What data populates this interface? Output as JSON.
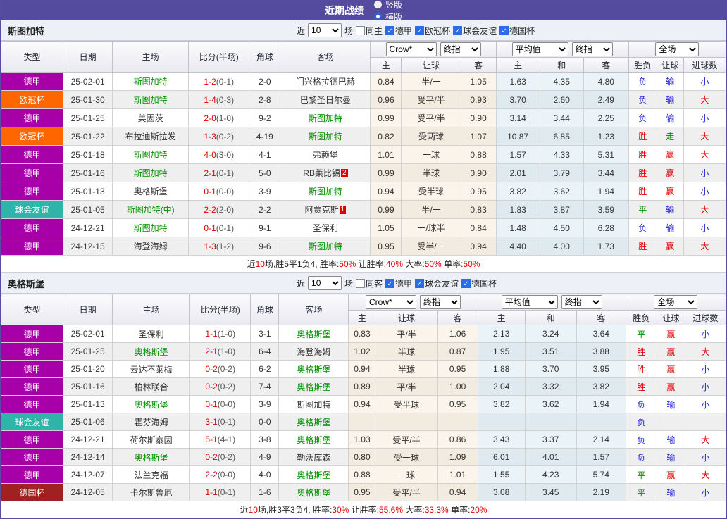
{
  "page": {
    "title": "近期战绩",
    "view_options": [
      {
        "label": "竖版",
        "checked": false
      },
      {
        "label": "横版",
        "checked": true
      }
    ]
  },
  "columns": {
    "main": [
      "类型",
      "日期",
      "主场",
      "比分(半场)",
      "角球",
      "客场"
    ],
    "sub": [
      "主",
      "让球",
      "客",
      "主",
      "和",
      "客",
      "胜负",
      "让球",
      "进球数"
    ],
    "selects": {
      "book": "Crow*",
      "final_a": "终指",
      "avg": "平均值",
      "final_b": "终指",
      "scope": "全场"
    }
  },
  "league_colors": {
    "德甲": "#a800a8",
    "欧冠杯": "#ff6600",
    "球会友谊": "#2fb4a9",
    "德国杯": "#a02121"
  },
  "result_colors": {
    "red": "#e00000",
    "blue": "#2424d8",
    "green": "#009000"
  },
  "sections": [
    {
      "team": "斯图加特",
      "filter": {
        "near": "近",
        "count": "10",
        "games": "场",
        "same": "同主",
        "leagues": [
          "德甲",
          "欧冠杯",
          "球会友谊",
          "德国杯"
        ]
      },
      "rows": [
        {
          "league": "德甲",
          "date": "25-02-01",
          "home": {
            "name": "斯图加特",
            "hl": true,
            "badge": null
          },
          "score": {
            "full": "1-2",
            "half": "(0-1)"
          },
          "corner": "2-0",
          "away": {
            "name": "门兴格拉德巴赫",
            "hl": false,
            "badge": null
          },
          "odds": [
            "0.84",
            "半/一",
            "1.05",
            "1.63",
            "4.35",
            "4.80"
          ],
          "results": [
            {
              "text": "负",
              "color": "blue"
            },
            {
              "text": "输",
              "color": "blue"
            },
            {
              "text": "小",
              "color": "blue"
            }
          ]
        },
        {
          "league": "欧冠杯",
          "date": "25-01-30",
          "home": {
            "name": "斯图加特",
            "hl": true,
            "badge": null
          },
          "score": {
            "full": "1-4",
            "half": "(0-3)"
          },
          "corner": "2-8",
          "away": {
            "name": "巴黎圣日尔曼",
            "hl": false,
            "badge": null
          },
          "odds": [
            "0.96",
            "受平/半",
            "0.93",
            "3.70",
            "2.60",
            "2.49"
          ],
          "results": [
            {
              "text": "负",
              "color": "blue"
            },
            {
              "text": "输",
              "color": "blue"
            },
            {
              "text": "大",
              "color": "red"
            }
          ]
        },
        {
          "league": "德甲",
          "date": "25-01-25",
          "home": {
            "name": "美因茨",
            "hl": false,
            "badge": null
          },
          "score": {
            "full": "2-0",
            "half": "(1-0)"
          },
          "corner": "9-2",
          "away": {
            "name": "斯图加特",
            "hl": true,
            "badge": null
          },
          "odds": [
            "0.99",
            "受平/半",
            "0.90",
            "3.14",
            "3.44",
            "2.25"
          ],
          "results": [
            {
              "text": "负",
              "color": "blue"
            },
            {
              "text": "输",
              "color": "blue"
            },
            {
              "text": "小",
              "color": "blue"
            }
          ]
        },
        {
          "league": "欧冠杯",
          "date": "25-01-22",
          "home": {
            "name": "布拉迪斯拉发",
            "hl": false,
            "badge": null
          },
          "score": {
            "full": "1-3",
            "half": "(0-2)"
          },
          "corner": "4-19",
          "away": {
            "name": "斯图加特",
            "hl": true,
            "badge": null
          },
          "odds": [
            "0.82",
            "受两球",
            "1.07",
            "10.87",
            "6.85",
            "1.23"
          ],
          "results": [
            {
              "text": "胜",
              "color": "red"
            },
            {
              "text": "走",
              "color": "green"
            },
            {
              "text": "大",
              "color": "red"
            }
          ]
        },
        {
          "league": "德甲",
          "date": "25-01-18",
          "home": {
            "name": "斯图加特",
            "hl": true,
            "badge": null
          },
          "score": {
            "full": "4-0",
            "half": "(3-0)"
          },
          "corner": "4-1",
          "away": {
            "name": "弗赖堡",
            "hl": false,
            "badge": null
          },
          "odds": [
            "1.01",
            "一球",
            "0.88",
            "1.57",
            "4.33",
            "5.31"
          ],
          "results": [
            {
              "text": "胜",
              "color": "red"
            },
            {
              "text": "赢",
              "color": "red"
            },
            {
              "text": "大",
              "color": "red"
            }
          ]
        },
        {
          "league": "德甲",
          "date": "25-01-16",
          "home": {
            "name": "斯图加特",
            "hl": true,
            "badge": null
          },
          "score": {
            "full": "2-1",
            "half": "(0-1)"
          },
          "corner": "5-0",
          "away": {
            "name": "RB莱比锡",
            "hl": false,
            "badge": "2"
          },
          "odds": [
            "0.99",
            "半球",
            "0.90",
            "2.01",
            "3.79",
            "3.44"
          ],
          "results": [
            {
              "text": "胜",
              "color": "red"
            },
            {
              "text": "赢",
              "color": "red"
            },
            {
              "text": "小",
              "color": "blue"
            }
          ]
        },
        {
          "league": "德甲",
          "date": "25-01-13",
          "home": {
            "name": "奥格斯堡",
            "hl": false,
            "badge": null
          },
          "score": {
            "full": "0-1",
            "half": "(0-0)"
          },
          "corner": "3-9",
          "away": {
            "name": "斯图加特",
            "hl": true,
            "badge": null
          },
          "odds": [
            "0.94",
            "受半球",
            "0.95",
            "3.82",
            "3.62",
            "1.94"
          ],
          "results": [
            {
              "text": "胜",
              "color": "red"
            },
            {
              "text": "赢",
              "color": "red"
            },
            {
              "text": "小",
              "color": "blue"
            }
          ]
        },
        {
          "league": "球会友谊",
          "date": "25-01-05",
          "home": {
            "name": "斯图加特(中)",
            "hl": true,
            "badge": null
          },
          "score": {
            "full": "2-2",
            "half": "(2-0)"
          },
          "corner": "2-2",
          "away": {
            "name": "阿贾克斯",
            "hl": false,
            "badge": "1"
          },
          "odds": [
            "0.99",
            "半/一",
            "0.83",
            "1.83",
            "3.87",
            "3.59"
          ],
          "results": [
            {
              "text": "平",
              "color": "green"
            },
            {
              "text": "输",
              "color": "blue"
            },
            {
              "text": "大",
              "color": "red"
            }
          ]
        },
        {
          "league": "德甲",
          "date": "24-12-21",
          "home": {
            "name": "斯图加特",
            "hl": true,
            "badge": null
          },
          "score": {
            "full": "0-1",
            "half": "(0-1)"
          },
          "corner": "9-1",
          "away": {
            "name": "圣保利",
            "hl": false,
            "badge": null
          },
          "odds": [
            "1.05",
            "一/球半",
            "0.84",
            "1.48",
            "4.50",
            "6.28"
          ],
          "results": [
            {
              "text": "负",
              "color": "blue"
            },
            {
              "text": "输",
              "color": "blue"
            },
            {
              "text": "小",
              "color": "blue"
            }
          ]
        },
        {
          "league": "德甲",
          "date": "24-12-15",
          "home": {
            "name": "海登海姆",
            "hl": false,
            "badge": null
          },
          "score": {
            "full": "1-3",
            "half": "(1-2)"
          },
          "corner": "9-6",
          "away": {
            "name": "斯图加特",
            "hl": true,
            "badge": null
          },
          "odds": [
            "0.95",
            "受半/一",
            "0.94",
            "4.40",
            "4.00",
            "1.73"
          ],
          "results": [
            {
              "text": "胜",
              "color": "red"
            },
            {
              "text": "赢",
              "color": "red"
            },
            {
              "text": "大",
              "color": "red"
            }
          ]
        }
      ],
      "summary": [
        {
          "t": "近",
          "c": ""
        },
        {
          "t": "10",
          "c": "r"
        },
        {
          "t": "场,胜5平1负4, 胜率:",
          "c": ""
        },
        {
          "t": "50%",
          "c": "r"
        },
        {
          "t": " 让胜率:",
          "c": ""
        },
        {
          "t": "40%",
          "c": "r"
        },
        {
          "t": " 大率:",
          "c": ""
        },
        {
          "t": "50%",
          "c": "r"
        },
        {
          "t": " 单率:",
          "c": ""
        },
        {
          "t": "50%",
          "c": "r"
        }
      ]
    },
    {
      "team": "奥格斯堡",
      "filter": {
        "near": "近",
        "count": "10",
        "games": "场",
        "same": "同客",
        "leagues": [
          "德甲",
          "球会友谊",
          "德国杯"
        ]
      },
      "rows": [
        {
          "league": "德甲",
          "date": "25-02-01",
          "home": {
            "name": "圣保利",
            "hl": false,
            "badge": null
          },
          "score": {
            "full": "1-1",
            "half": "(1-0)"
          },
          "corner": "3-1",
          "away": {
            "name": "奥格斯堡",
            "hl": true,
            "badge": null
          },
          "odds": [
            "0.83",
            "平/半",
            "1.06",
            "2.13",
            "3.24",
            "3.64"
          ],
          "results": [
            {
              "text": "平",
              "color": "green"
            },
            {
              "text": "赢",
              "color": "red"
            },
            {
              "text": "小",
              "color": "blue"
            }
          ]
        },
        {
          "league": "德甲",
          "date": "25-01-25",
          "home": {
            "name": "奥格斯堡",
            "hl": true,
            "badge": null
          },
          "score": {
            "full": "2-1",
            "half": "(1-0)"
          },
          "corner": "6-4",
          "away": {
            "name": "海登海姆",
            "hl": false,
            "badge": null
          },
          "odds": [
            "1.02",
            "半球",
            "0.87",
            "1.95",
            "3.51",
            "3.88"
          ],
          "results": [
            {
              "text": "胜",
              "color": "red"
            },
            {
              "text": "赢",
              "color": "red"
            },
            {
              "text": "大",
              "color": "red"
            }
          ]
        },
        {
          "league": "德甲",
          "date": "25-01-20",
          "home": {
            "name": "云达不莱梅",
            "hl": false,
            "badge": null
          },
          "score": {
            "full": "0-2",
            "half": "(0-2)"
          },
          "corner": "6-2",
          "away": {
            "name": "奥格斯堡",
            "hl": true,
            "badge": null
          },
          "odds": [
            "0.94",
            "半球",
            "0.95",
            "1.88",
            "3.70",
            "3.95"
          ],
          "results": [
            {
              "text": "胜",
              "color": "red"
            },
            {
              "text": "赢",
              "color": "red"
            },
            {
              "text": "小",
              "color": "blue"
            }
          ]
        },
        {
          "league": "德甲",
          "date": "25-01-16",
          "home": {
            "name": "柏林联合",
            "hl": false,
            "badge": null
          },
          "score": {
            "full": "0-2",
            "half": "(0-2)"
          },
          "corner": "7-4",
          "away": {
            "name": "奥格斯堡",
            "hl": true,
            "badge": null
          },
          "odds": [
            "0.89",
            "平/半",
            "1.00",
            "2.04",
            "3.32",
            "3.82"
          ],
          "results": [
            {
              "text": "胜",
              "color": "red"
            },
            {
              "text": "赢",
              "color": "red"
            },
            {
              "text": "小",
              "color": "blue"
            }
          ]
        },
        {
          "league": "德甲",
          "date": "25-01-13",
          "home": {
            "name": "奥格斯堡",
            "hl": true,
            "badge": null
          },
          "score": {
            "full": "0-1",
            "half": "(0-0)"
          },
          "corner": "3-9",
          "away": {
            "name": "斯图加特",
            "hl": false,
            "badge": null
          },
          "odds": [
            "0.94",
            "受半球",
            "0.95",
            "3.82",
            "3.62",
            "1.94"
          ],
          "results": [
            {
              "text": "负",
              "color": "blue"
            },
            {
              "text": "输",
              "color": "blue"
            },
            {
              "text": "小",
              "color": "blue"
            }
          ]
        },
        {
          "league": "球会友谊",
          "date": "25-01-06",
          "home": {
            "name": "霍芬海姆",
            "hl": false,
            "badge": null
          },
          "score": {
            "full": "3-1",
            "half": "(0-1)"
          },
          "corner": "0-0",
          "away": {
            "name": "奥格斯堡",
            "hl": true,
            "badge": null
          },
          "odds": [
            "",
            "",
            "",
            "",
            "",
            ""
          ],
          "results": [
            {
              "text": "负",
              "color": "blue"
            },
            {
              "text": "",
              "color": ""
            },
            {
              "text": "",
              "color": ""
            }
          ]
        },
        {
          "league": "德甲",
          "date": "24-12-21",
          "home": {
            "name": "荷尔斯泰因",
            "hl": false,
            "badge": null
          },
          "score": {
            "full": "5-1",
            "half": "(4-1)"
          },
          "corner": "3-8",
          "away": {
            "name": "奥格斯堡",
            "hl": true,
            "badge": null
          },
          "odds": [
            "1.03",
            "受平/半",
            "0.86",
            "3.43",
            "3.37",
            "2.14"
          ],
          "results": [
            {
              "text": "负",
              "color": "blue"
            },
            {
              "text": "输",
              "color": "blue"
            },
            {
              "text": "大",
              "color": "red"
            }
          ]
        },
        {
          "league": "德甲",
          "date": "24-12-14",
          "home": {
            "name": "奥格斯堡",
            "hl": true,
            "badge": null
          },
          "score": {
            "full": "0-2",
            "half": "(0-2)"
          },
          "corner": "4-9",
          "away": {
            "name": "勒沃库森",
            "hl": false,
            "badge": null
          },
          "odds": [
            "0.80",
            "受一球",
            "1.09",
            "6.01",
            "4.01",
            "1.57"
          ],
          "results": [
            {
              "text": "负",
              "color": "blue"
            },
            {
              "text": "输",
              "color": "blue"
            },
            {
              "text": "小",
              "color": "blue"
            }
          ]
        },
        {
          "league": "德甲",
          "date": "24-12-07",
          "home": {
            "name": "法兰克福",
            "hl": false,
            "badge": null
          },
          "score": {
            "full": "2-2",
            "half": "(0-0)"
          },
          "corner": "4-0",
          "away": {
            "name": "奥格斯堡",
            "hl": true,
            "badge": null
          },
          "odds": [
            "0.88",
            "一球",
            "1.01",
            "1.55",
            "4.23",
            "5.74"
          ],
          "results": [
            {
              "text": "平",
              "color": "green"
            },
            {
              "text": "赢",
              "color": "red"
            },
            {
              "text": "大",
              "color": "red"
            }
          ]
        },
        {
          "league": "德国杯",
          "date": "24-12-05",
          "home": {
            "name": "卡尔斯鲁厄",
            "hl": false,
            "badge": null
          },
          "score": {
            "full": "1-1",
            "half": "(0-1)"
          },
          "corner": "1-6",
          "away": {
            "name": "奥格斯堡",
            "hl": true,
            "badge": null
          },
          "odds": [
            "0.95",
            "受平/半",
            "0.94",
            "3.08",
            "3.45",
            "2.19"
          ],
          "results": [
            {
              "text": "平",
              "color": "green"
            },
            {
              "text": "输",
              "color": "blue"
            },
            {
              "text": "小",
              "color": "blue"
            }
          ]
        }
      ],
      "summary": [
        {
          "t": "近",
          "c": ""
        },
        {
          "t": "10",
          "c": "r"
        },
        {
          "t": "场,胜3平3负4, 胜率:",
          "c": ""
        },
        {
          "t": "30%",
          "c": "r"
        },
        {
          "t": " 让胜率:",
          "c": ""
        },
        {
          "t": "55.6%",
          "c": "r"
        },
        {
          "t": " 大率:",
          "c": ""
        },
        {
          "t": "33.3%",
          "c": "r"
        },
        {
          "t": " 单率:",
          "c": ""
        },
        {
          "t": "20%",
          "c": "r"
        }
      ]
    }
  ]
}
